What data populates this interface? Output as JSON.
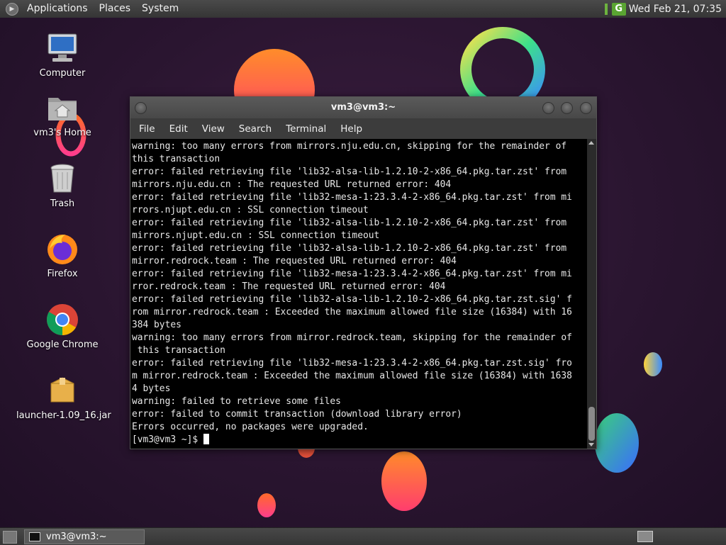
{
  "top_panel": {
    "menus": [
      "Applications",
      "Places",
      "System"
    ],
    "clock": "Wed Feb 21, 07:35",
    "app_badge": "G"
  },
  "desktop_icons": [
    {
      "label": "Computer",
      "icon": "computer-icon"
    },
    {
      "label": "vm3's Home",
      "icon": "home-folder-icon"
    },
    {
      "label": "Trash",
      "icon": "trash-icon"
    },
    {
      "label": "Firefox",
      "icon": "firefox-icon"
    },
    {
      "label": "Google Chrome",
      "icon": "chrome-icon"
    },
    {
      "label": "launcher-1.09_16.jar",
      "icon": "jar-file-icon"
    }
  ],
  "terminal": {
    "title": "vm3@vm3:~",
    "menu": [
      "File",
      "Edit",
      "View",
      "Search",
      "Terminal",
      "Help"
    ],
    "lines": [
      "warning: too many errors from mirrors.nju.edu.cn, skipping for the remainder of",
      "this transaction",
      "error: failed retrieving file 'lib32-alsa-lib-1.2.10-2-x86_64.pkg.tar.zst' from",
      "mirrors.nju.edu.cn : The requested URL returned error: 404",
      "error: failed retrieving file 'lib32-mesa-1:23.3.4-2-x86_64.pkg.tar.zst' from mi",
      "rrors.njupt.edu.cn : SSL connection timeout",
      "error: failed retrieving file 'lib32-alsa-lib-1.2.10-2-x86_64.pkg.tar.zst' from",
      "mirrors.njupt.edu.cn : SSL connection timeout",
      "error: failed retrieving file 'lib32-alsa-lib-1.2.10-2-x86_64.pkg.tar.zst' from",
      "mirror.redrock.team : The requested URL returned error: 404",
      "error: failed retrieving file 'lib32-mesa-1:23.3.4-2-x86_64.pkg.tar.zst' from mi",
      "rror.redrock.team : The requested URL returned error: 404",
      "error: failed retrieving file 'lib32-alsa-lib-1.2.10-2-x86_64.pkg.tar.zst.sig' f",
      "rom mirror.redrock.team : Exceeded the maximum allowed file size (16384) with 16",
      "384 bytes",
      "warning: too many errors from mirror.redrock.team, skipping for the remainder of",
      " this transaction",
      "error: failed retrieving file 'lib32-mesa-1:23.3.4-2-x86_64.pkg.tar.zst.sig' fro",
      "m mirror.redrock.team : Exceeded the maximum allowed file size (16384) with 1638",
      "4 bytes",
      "warning: failed to retrieve some files",
      "error: failed to commit transaction (download library error)",
      "Errors occurred, no packages were upgraded."
    ],
    "prompt": "[vm3@vm3 ~]$ "
  },
  "bottom_panel": {
    "task_label": "vm3@vm3:~"
  }
}
